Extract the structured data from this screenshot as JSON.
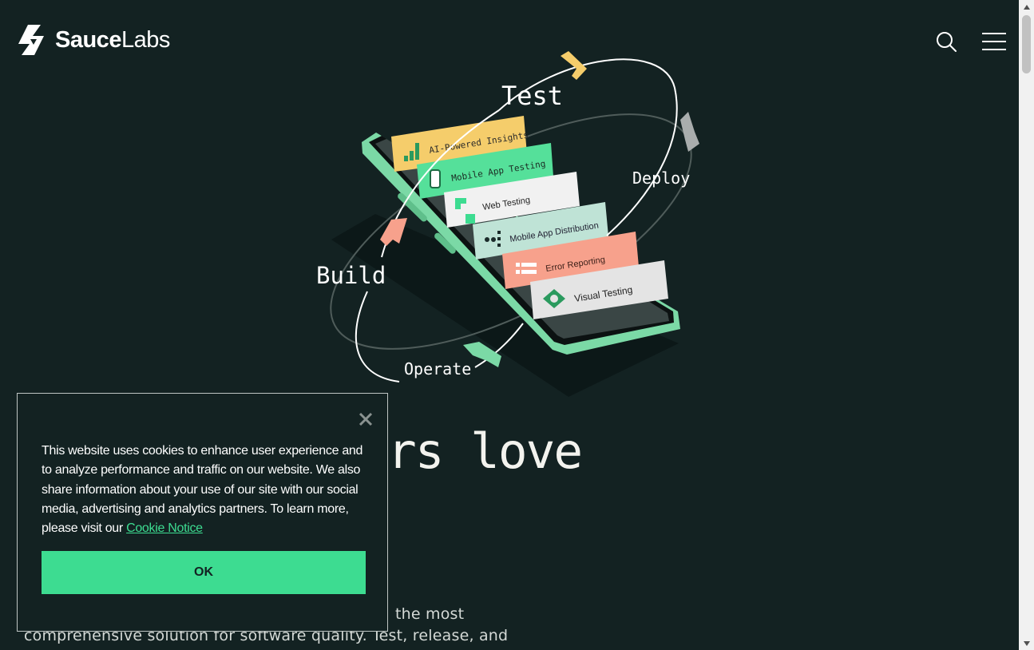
{
  "brand": {
    "name_bold": "Sauce",
    "name_regular": "Labs",
    "icon": "saucelabs-logo-icon"
  },
  "header": {
    "search_icon": "search-icon",
    "menu_icon": "hamburger-menu-icon"
  },
  "hero": {
    "cycle_labels": {
      "test": "Test",
      "deploy": "Deploy",
      "operate": "Operate",
      "build": "Build"
    },
    "cards": [
      {
        "label": "AI-Powered Insights",
        "icon": "bar-chart-icon",
        "color": "#f5cd6b"
      },
      {
        "label": "Mobile App Testing",
        "icon": "phone-icon",
        "color": "#55e09a"
      },
      {
        "label": "Web Testing",
        "icon": "web-icon",
        "color": "#f1f1f1"
      },
      {
        "label": "Mobile App Distribution",
        "icon": "distribution-icon",
        "color": "#bfe3d6"
      },
      {
        "label": "Error Reporting",
        "icon": "list-icon",
        "color": "#f7a18c"
      },
      {
        "label": "Visual Testing",
        "icon": "eye-icon",
        "color": "#e4e4e4"
      }
    ],
    "headline_visible": "rs love",
    "description_line1_visible": "the most",
    "description_line2": "comprehensive solution for software quality. Test, release, and"
  },
  "cookie_banner": {
    "text": "This website uses cookies to enhance user experience and to analyze performance and traffic on our website. We also share information about your use of our site with our social media, advertising and analytics partners. To learn more, please visit our ",
    "link_label": "Cookie Notice",
    "ok_label": "OK",
    "close_icon": "close-icon"
  },
  "colors": {
    "background": "#132222",
    "accent": "#3ddc91",
    "phone": "#7bd9a6"
  }
}
